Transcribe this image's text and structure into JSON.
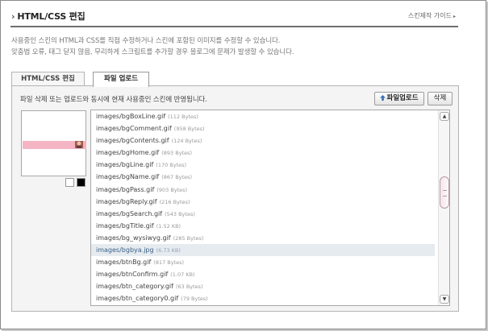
{
  "header": {
    "title": "HTML/CSS 편집",
    "guide_link": "스킨제작 가이드",
    "description_line1": "사용중인 스킨의 HTML과 CSS를 직접 수정하거나 스킨에 포함된 이미지를 수정할 수 있습니다.",
    "description_line2": "맞춤법 오류, 태그 닫지 않음, 무리하게 스크립트를 추가할 경우 블로그에 문제가 발생할 수 있습니다."
  },
  "tabs": [
    {
      "label": "HTML/CSS 편집",
      "active": false
    },
    {
      "label": "파일 업로드",
      "active": true
    }
  ],
  "panel": {
    "info": "파일 삭제 또는 업로드와 동시에 현재 사용중인 스킨에 반영됩니다.",
    "upload_button": "파일업로드",
    "delete_button": "삭제"
  },
  "colors": {
    "preview_bar": "#f4b4c4",
    "selected_row": "#e6ebf0",
    "swatch_white": "#ffffff",
    "swatch_black": "#000000"
  },
  "files": [
    {
      "name": "images/bgBoxLine.gif",
      "size": "(112 Bytes)",
      "selected": false
    },
    {
      "name": "images/bgComment.gif",
      "size": "(958 Bytes)",
      "selected": false
    },
    {
      "name": "images/bgContents.gif",
      "size": "(124 Bytes)",
      "selected": false
    },
    {
      "name": "images/bgHome.gif",
      "size": "(893 Bytes)",
      "selected": false
    },
    {
      "name": "images/bgLine.gif",
      "size": "(170 Bytes)",
      "selected": false
    },
    {
      "name": "images/bgName.gif",
      "size": "(867 Bytes)",
      "selected": false
    },
    {
      "name": "images/bgPass.gif",
      "size": "(903 Bytes)",
      "selected": false
    },
    {
      "name": "images/bgReply.gif",
      "size": "(216 Bytes)",
      "selected": false
    },
    {
      "name": "images/bgSearch.gif",
      "size": "(543 Bytes)",
      "selected": false
    },
    {
      "name": "images/bgTitle.gif",
      "size": "(1.52 KB)",
      "selected": false
    },
    {
      "name": "images/bg_wysiwyg.gif",
      "size": "(285 Bytes)",
      "selected": false
    },
    {
      "name": "images/bgbya.jpg",
      "size": "(6.73 KB)",
      "selected": true
    },
    {
      "name": "images/btnBg.gif",
      "size": "(817 Bytes)",
      "selected": false
    },
    {
      "name": "images/btnConfirm.gif",
      "size": "(1.07 KB)",
      "selected": false
    },
    {
      "name": "images/btn_category.gif",
      "size": "(63 Bytes)",
      "selected": false
    },
    {
      "name": "images/btn_category0.gif",
      "size": "(79 Bytes)",
      "selected": false
    }
  ]
}
